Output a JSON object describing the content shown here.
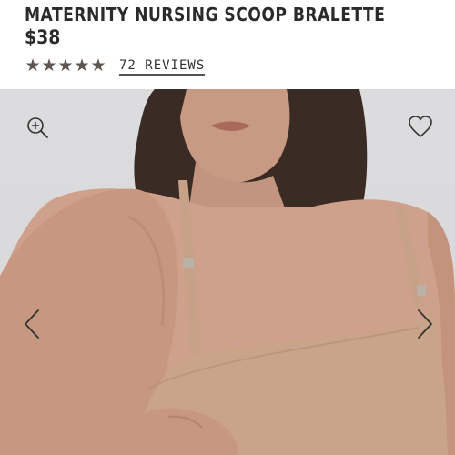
{
  "product": {
    "title": "MATERNITY NURSING SCOOP BRALETTE",
    "price": "$38",
    "rating_stars": 5,
    "reviews_label": "72 REVIEWS"
  },
  "gallery": {
    "image_alt": "Model wearing maternity nursing scoop bralette",
    "icons": {
      "zoom": "zoom-in-icon",
      "favorite": "heart-icon",
      "previous": "chevron-left-icon",
      "next": "chevron-right-icon"
    }
  },
  "colors": {
    "text": "#2b2b2b",
    "stars": "#5f574f",
    "background": "#dcdcde",
    "product": "#c29f86"
  }
}
